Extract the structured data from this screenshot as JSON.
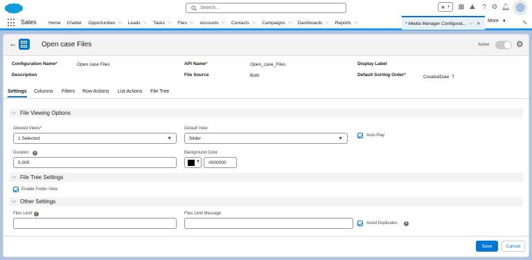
{
  "global": {
    "search_placeholder": "Search...",
    "brand_color": "#0176d3"
  },
  "nav": {
    "app_name": "Sales",
    "items": [
      {
        "label": "Home",
        "dropdown": false
      },
      {
        "label": "Chatter",
        "dropdown": false
      },
      {
        "label": "Opportunities",
        "dropdown": true
      },
      {
        "label": "Leads",
        "dropdown": true
      },
      {
        "label": "Tasks",
        "dropdown": true
      },
      {
        "label": "Files",
        "dropdown": true
      },
      {
        "label": "Accounts",
        "dropdown": true
      },
      {
        "label": "Contacts",
        "dropdown": true
      },
      {
        "label": "Campaigns",
        "dropdown": true
      },
      {
        "label": "Dashboards",
        "dropdown": true
      },
      {
        "label": "Reports",
        "dropdown": true
      }
    ],
    "active_tab": "* Media Manager Configurat...",
    "more_label": "More"
  },
  "page": {
    "title": "Open case Files",
    "active_label": "Active",
    "fields": {
      "config_name_label": "Configuration Name",
      "config_name_value": "Open case Files",
      "api_name_label": "API Name",
      "api_name_value": "Open_case_Files",
      "display_label_label": "Display Label",
      "description_label": "Description",
      "file_source_label": "File Source",
      "file_source_value": "Both",
      "sort_order_label": "Default Sorting Order",
      "sort_order_value": "CreatedDate"
    },
    "tabs": [
      "Settings",
      "Columns",
      "Filters",
      "Row Actions",
      "List Actions",
      "File Tree"
    ]
  },
  "sections": {
    "file_viewing": {
      "title": "File Viewing Options",
      "allowed_views_label": "Allowed Views",
      "allowed_views_value": "1 Selected",
      "default_view_label": "Default View",
      "default_view_value": "Slider",
      "auto_play_label": "Auto-Play",
      "duration_label": "Duration",
      "duration_value": "5,000",
      "bg_color_label": "Background Color",
      "bg_color_value": "#000000"
    },
    "file_tree": {
      "title": "File Tree Settings",
      "enable_folder_label": "Enable Folder View"
    },
    "other": {
      "title": "Other Settings",
      "files_limit_label": "Files Limit",
      "files_limit_message_label": "Files Limit Message",
      "avoid_duplicates_label": "Avoid Duplicates"
    }
  },
  "footer": {
    "save_label": "Save",
    "cancel_label": "Cancel"
  }
}
